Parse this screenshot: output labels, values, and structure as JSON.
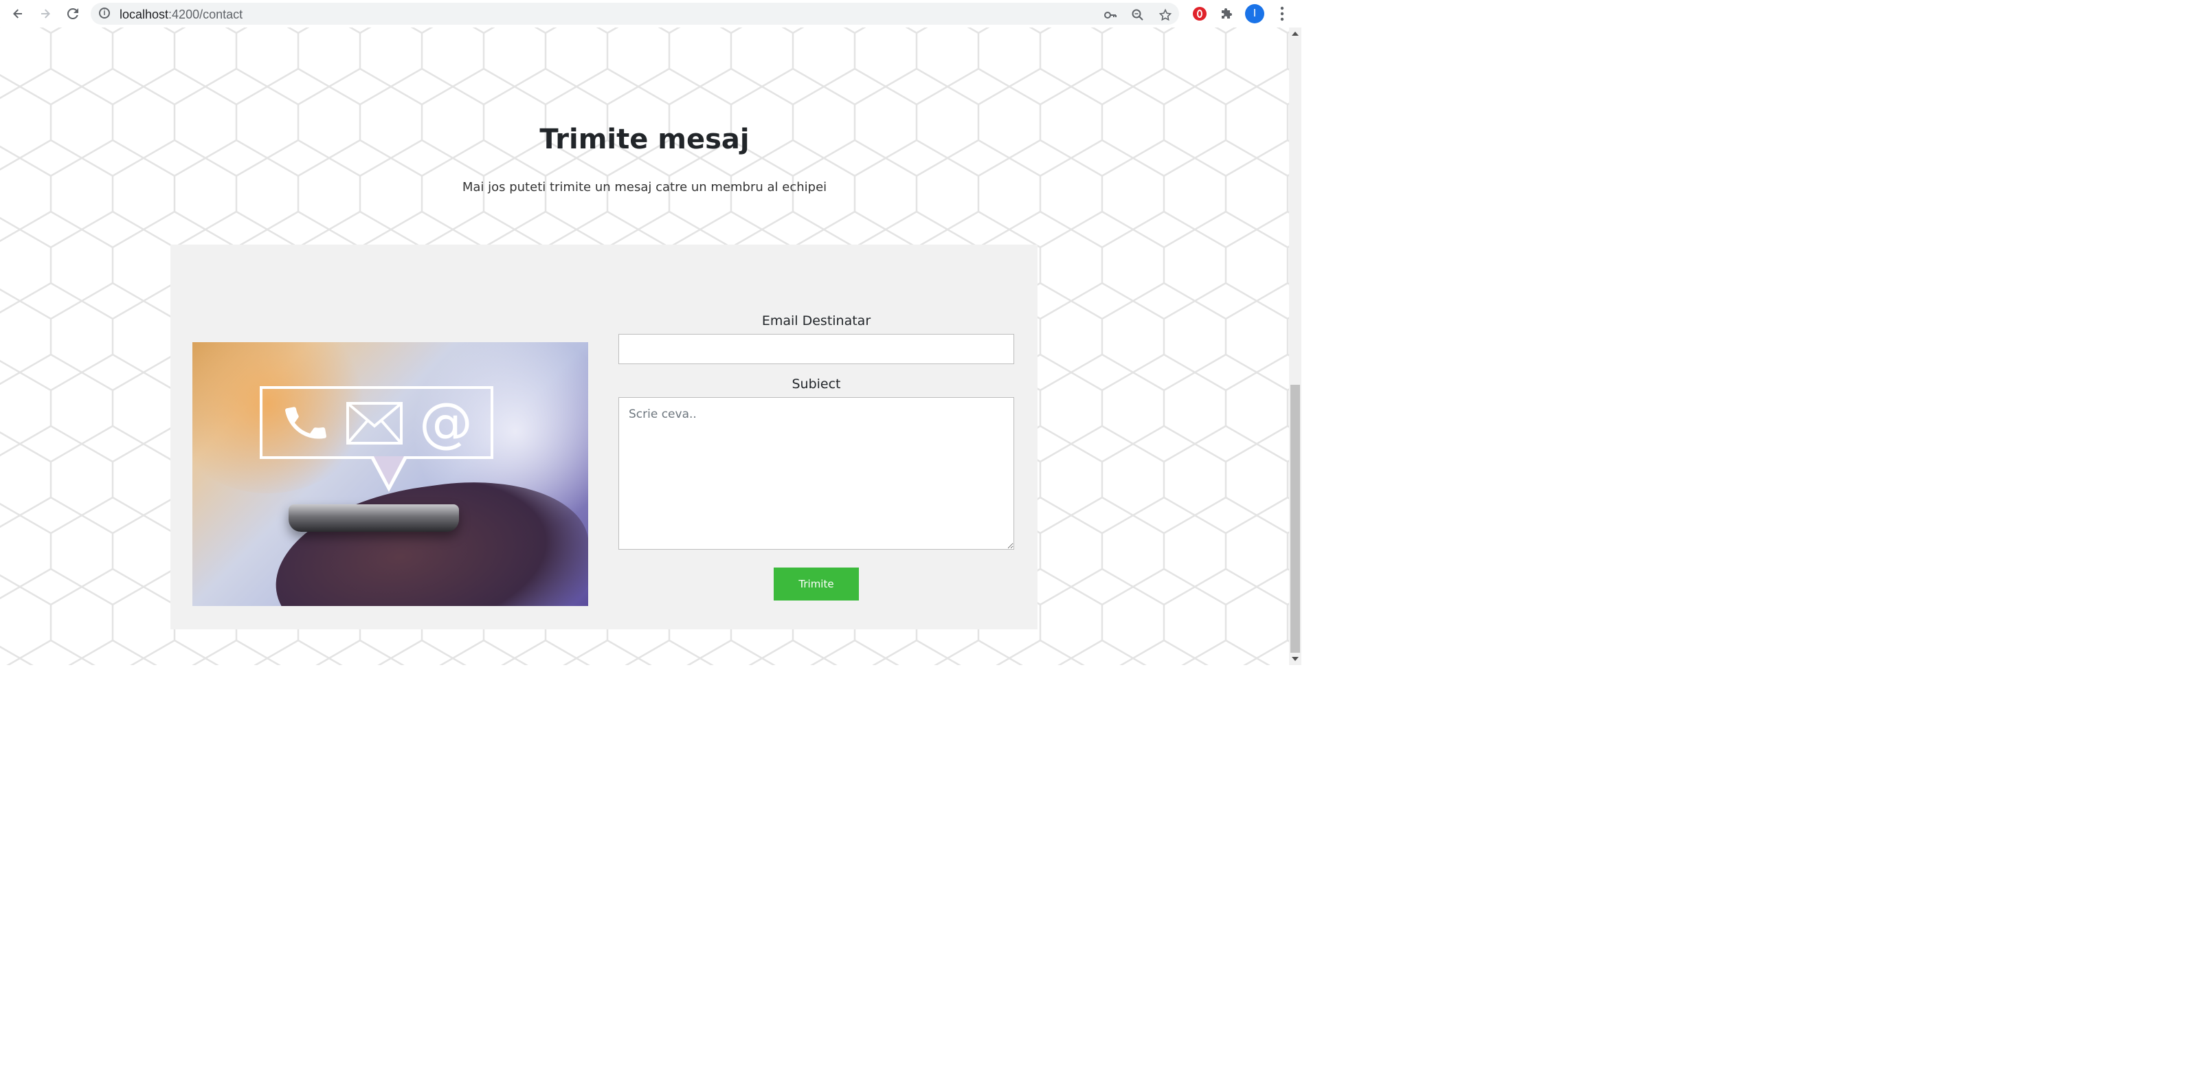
{
  "browser": {
    "url_host": "localhost",
    "url_path": ":4200/contact",
    "avatar_letter": "I",
    "icons": {
      "back": "arrow-left-icon",
      "forward": "arrow-right-icon",
      "reload": "reload-icon",
      "info": "info-icon",
      "key": "key-icon",
      "zoom": "zoom-icon",
      "star": "star-icon",
      "opera": "opera-icon",
      "extensions": "puzzle-icon",
      "menu": "kebab-menu-icon"
    }
  },
  "page": {
    "title": "Trimite mesaj",
    "subtitle": "Mai jos puteti trimite un mesaj catre un membru al echipei"
  },
  "form": {
    "email_label": "Email Destinatar",
    "email_value": "",
    "subject_label": "Subiect",
    "subject_placeholder": "Scrie ceva..",
    "subject_value": "",
    "submit_label": "Trimite"
  },
  "colors": {
    "button": "#3cba3c",
    "card_bg": "#f1f1f1",
    "title": "#212529"
  }
}
